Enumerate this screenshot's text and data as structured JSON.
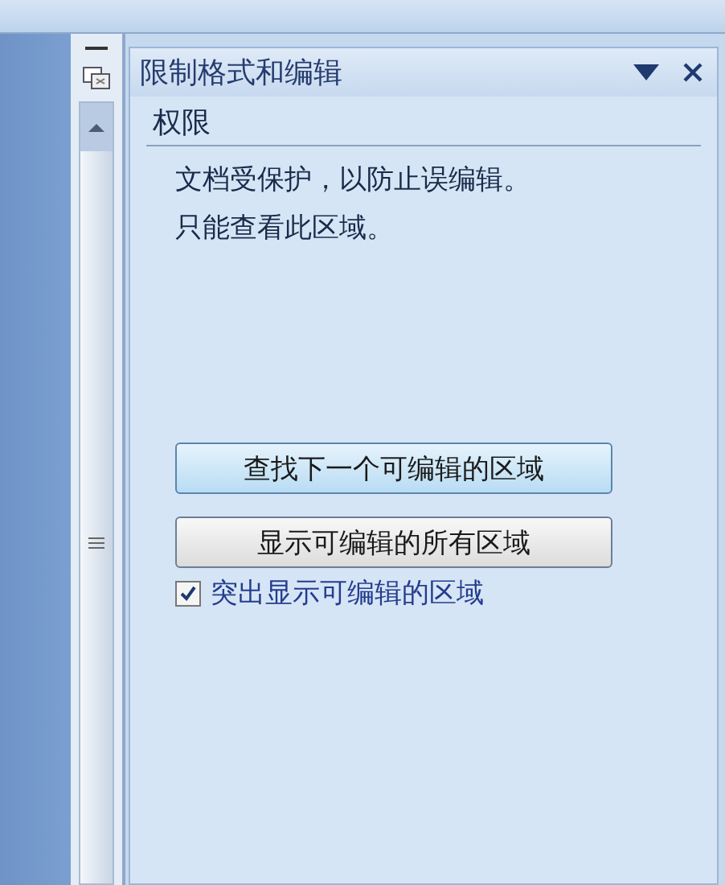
{
  "pane": {
    "title": "限制格式和编辑",
    "section": "权限",
    "lines": [
      "文档受保护，以防止误编辑。",
      "只能查看此区域。"
    ],
    "buttons": [
      {
        "label": "查找下一个可编辑的区域",
        "kind": "highlighted"
      },
      {
        "label": "显示可编辑的所有区域",
        "kind": "normal"
      }
    ],
    "highlight": {
      "label": "突出显示可编辑的区域",
      "checked": true
    }
  }
}
